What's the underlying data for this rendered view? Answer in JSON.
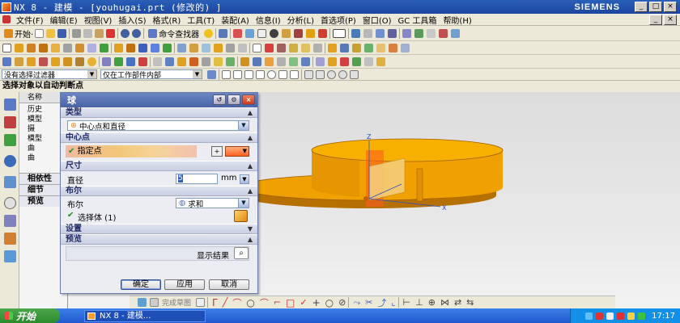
{
  "window": {
    "title": "NX 8 - 建模 - [youhugai.prt  (修改的) ]",
    "brand": "SIEMENS",
    "min": "_",
    "max": "□",
    "close": "×"
  },
  "menubar": {
    "items": [
      "文件(F)",
      "编辑(E)",
      "视图(V)",
      "插入(S)",
      "格式(R)",
      "工具(T)",
      "装配(A)",
      "信息(I)",
      "分析(L)",
      "首选项(P)",
      "窗口(O)",
      "GC 工具箱",
      "帮助(H)"
    ]
  },
  "toolbar": {
    "start_label": "开始·",
    "command_finder": "命令查找器"
  },
  "selection": {
    "filter": "没有选择过滤器",
    "scope": "仅在工作部件内部"
  },
  "status_line": "选择对象以自动判断点",
  "navigator": {
    "header": "名称",
    "rows": [
      "历史",
      "模型",
      "摄",
      "模型",
      "曲",
      "曲"
    ],
    "sections": [
      "相依性",
      "细节",
      "预览"
    ]
  },
  "dialog": {
    "title": "球",
    "type_section": "类型",
    "type_value": "中心点和直径",
    "center_section": "中心点",
    "specify_point": "指定点",
    "size_section": "尺寸",
    "diameter_label": "直径",
    "diameter_value": "5",
    "diameter_unit": "mm",
    "boolean_section": "布尔",
    "boolean_label": "布尔",
    "boolean_value": "求和",
    "select_body": "选择体 (1)",
    "settings_section": "设置",
    "preview_section": "预览",
    "show_result": "显示结果",
    "ok": "确定",
    "apply": "应用",
    "cancel": "取消"
  },
  "cmdbar": {
    "label": "完成草图"
  },
  "taskbar": {
    "start": "开始",
    "task": "NX 8 - 建模...",
    "clock": "17:17"
  },
  "colors": {
    "model_orange": "#f0a000",
    "preview_red": "#ff5a20",
    "title_blue": "#2a5fb8"
  }
}
